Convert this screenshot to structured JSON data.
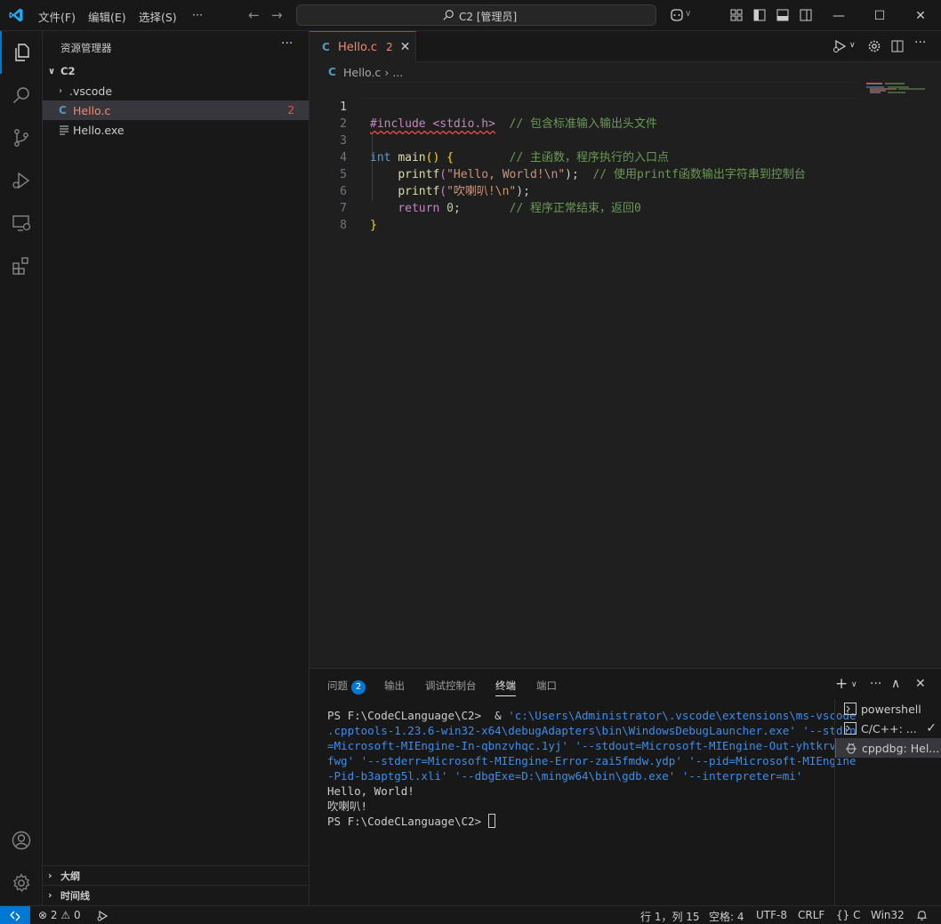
{
  "titlebar": {
    "menus": [
      "文件(F)",
      "编辑(E)",
      "选择(S)",
      "···"
    ],
    "search_text": "C2 [管理员]",
    "window_controls": {
      "minimize": "—",
      "maximize": "☐",
      "close": "✕"
    }
  },
  "sidebar": {
    "title": "资源管理器",
    "more": "···",
    "root": "C2",
    "items": [
      {
        "label": ".vscode",
        "type": "folder"
      },
      {
        "label": "Hello.c",
        "type": "c-file",
        "badge": "2",
        "icon_text": "C"
      },
      {
        "label": "Hello.exe",
        "type": "file"
      }
    ],
    "sections": [
      "大纲",
      "时间线"
    ]
  },
  "editor": {
    "tab": {
      "icon_text": "C",
      "name": "Hello.c",
      "problems": "2",
      "close": "✕"
    },
    "breadcrumb": {
      "icon_text": "C",
      "file": "Hello.c",
      "sep": "›",
      "rest": "..."
    },
    "line_numbers": [
      "1",
      "2",
      "3",
      "4",
      "5",
      "6",
      "7",
      "8"
    ],
    "lines": [
      {
        "include": "#include <stdio.h>",
        "comment": "// 包含标准输入输出头文件"
      },
      {},
      {
        "kw": "int",
        "fn": "main",
        "paren": "()",
        "brace": "{",
        "comment": "// 主函数，程序执行的入口点"
      },
      {
        "fn": "printf",
        "open": "(",
        "str": "\"Hello, World!\\n\"",
        "close": ");",
        "comment": "// 使用printf函数输出字符串到控制台"
      },
      {
        "fn": "printf",
        "open": "(",
        "str": "\"吹喇叭!\\n\"",
        "close": ");"
      },
      {
        "kw": "return",
        "num": "0",
        "semi": ";",
        "comment": "// 程序正常结束，返回0"
      },
      {
        "brace": "}"
      },
      {}
    ]
  },
  "panel": {
    "tabs": [
      {
        "label": "问题",
        "badge": "2"
      },
      {
        "label": "输出"
      },
      {
        "label": "调试控制台"
      },
      {
        "label": "终端",
        "active": true
      },
      {
        "label": "端口"
      }
    ],
    "terminal": {
      "prompt": "PS F:\\CodeCLanguage\\C2> ",
      "command_prefix": " & ",
      "command_lines": [
        "'c:\\Users\\Administrator\\.vscode\\extensions\\ms-vscode",
        ".cpptools-1.23.6-win32-x64\\debugAdapters\\bin\\WindowsDebugLauncher.exe' '--stdin",
        "=Microsoft-MIEngine-In-qbnzvhqc.1yj' '--stdout=Microsoft-MIEngine-Out-yhtkrvtb.",
        "fwg' '--stderr=Microsoft-MIEngine-Error-zai5fmdw.ydp' '--pid=Microsoft-MIEngine",
        "-Pid-b3aptg5l.xli' '--dbgExe=D:\\mingw64\\bin\\gdb.exe' '--interpreter=mi'"
      ],
      "output": [
        "Hello, World!",
        "吹喇叭!"
      ],
      "final_prompt": "PS F:\\CodeCLanguage\\C2> "
    },
    "terminal_list": [
      "powershell",
      "C/C++: ...",
      "cppdbg: Hel..."
    ]
  },
  "statusbar": {
    "errors": "2",
    "warnings": "0",
    "position": "行 1，列 15",
    "spaces": "空格: 4",
    "encoding": "UTF-8",
    "eol": "CRLF",
    "language": "{} C",
    "platform": "Win32"
  },
  "colors": {
    "accent": "#0078d4",
    "error": "#f14c4c",
    "background": "#1f1f1f",
    "sidebar": "#181818"
  }
}
